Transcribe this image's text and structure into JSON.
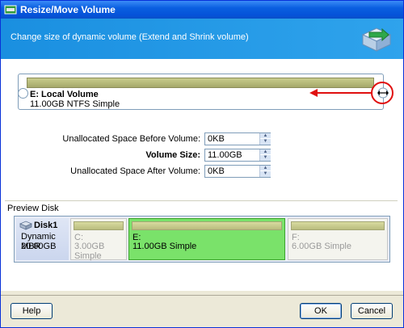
{
  "window": {
    "title": "Resize/Move Volume"
  },
  "header": {
    "subtitle": "Change size of dynamic volume (Extend and Shrink volume)"
  },
  "volume": {
    "name": "E: Local Volume",
    "info": "11.00GB NTFS Simple"
  },
  "form": {
    "before_label": "Unallocated Space Before Volume:",
    "before_value": "0KB",
    "size_label": "Volume Size:",
    "size_value": "11.00GB",
    "after_label": "Unallocated Space After Volume:",
    "after_value": "0KB"
  },
  "preview": {
    "label": "Preview Disk",
    "disk": {
      "name": "Disk1",
      "type": "Dynamic MBR",
      "size": "20.00GB"
    },
    "partitions": [
      {
        "label": "C:",
        "info": "3.00GB Simple"
      },
      {
        "label": "E:",
        "info": "11.00GB Simple"
      },
      {
        "label": "F:",
        "info": "6.00GB Simple"
      }
    ]
  },
  "buttons": {
    "help": "Help",
    "ok": "OK",
    "cancel": "Cancel"
  },
  "colors": {
    "title_bar": "#0553d9",
    "header": "#2fa3ec",
    "selected_partition": "#7ae26a",
    "arrow": "#e01010"
  }
}
